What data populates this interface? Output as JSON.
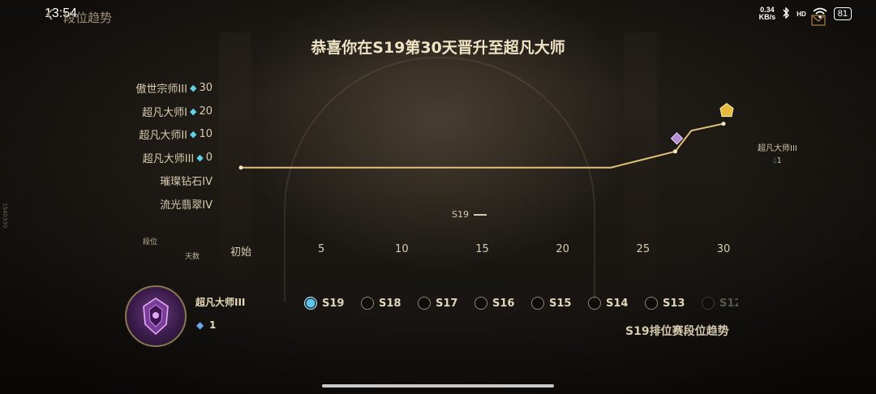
{
  "status_bar": {
    "time": "13:54",
    "net_speed_value": "0.34",
    "net_speed_unit": "KB/s",
    "network": "HD",
    "battery": "81"
  },
  "header": {
    "back_label": "段位趋势"
  },
  "title": "恭喜你在S19第30天晋升至超凡大师",
  "chart_data": {
    "type": "line",
    "y_categories": [
      {
        "label": "傲世宗师III",
        "points": "30"
      },
      {
        "label": "超凡大师I",
        "points": "20"
      },
      {
        "label": "超凡大师II",
        "points": "10"
      },
      {
        "label": "超凡大师III",
        "points": "0"
      },
      {
        "label": "璀璨钻石IV",
        "points": ""
      },
      {
        "label": "流光翡翠IV",
        "points": ""
      }
    ],
    "ylabel": "段位",
    "xlabel": "天数",
    "x_ticks": [
      "初始",
      "5",
      "10",
      "15",
      "20",
      "25",
      "30"
    ],
    "series": [
      {
        "name": "S19",
        "color": "#e0c27c",
        "points": [
          {
            "x": 0,
            "y": 1.5
          },
          {
            "x": 23,
            "y": 1.5
          },
          {
            "x": 25,
            "y": 1.85
          },
          {
            "x": 27,
            "y": 2.2
          },
          {
            "x": 28,
            "y": 3.1
          },
          {
            "x": 30,
            "y": 3.4
          }
        ]
      }
    ],
    "markers": [
      {
        "x": 27,
        "y": 2.2,
        "icon": "diamond-rank-icon"
      },
      {
        "x": 30,
        "y": 3.4,
        "icon": "master-rank-icon"
      }
    ],
    "end_label": {
      "rank": "超凡大师III",
      "points": "1"
    }
  },
  "current_rank": {
    "name": "超凡大师III",
    "points": "1"
  },
  "seasons": [
    {
      "label": "S19",
      "selected": true
    },
    {
      "label": "S18",
      "selected": false
    },
    {
      "label": "S17",
      "selected": false
    },
    {
      "label": "S16",
      "selected": false
    },
    {
      "label": "S15",
      "selected": false
    },
    {
      "label": "S14",
      "selected": false
    },
    {
      "label": "S13",
      "selected": false
    },
    {
      "label": "S12",
      "selected": false
    }
  ],
  "footer_title": "S19排位赛段位趋势",
  "side_tag": "1540330"
}
